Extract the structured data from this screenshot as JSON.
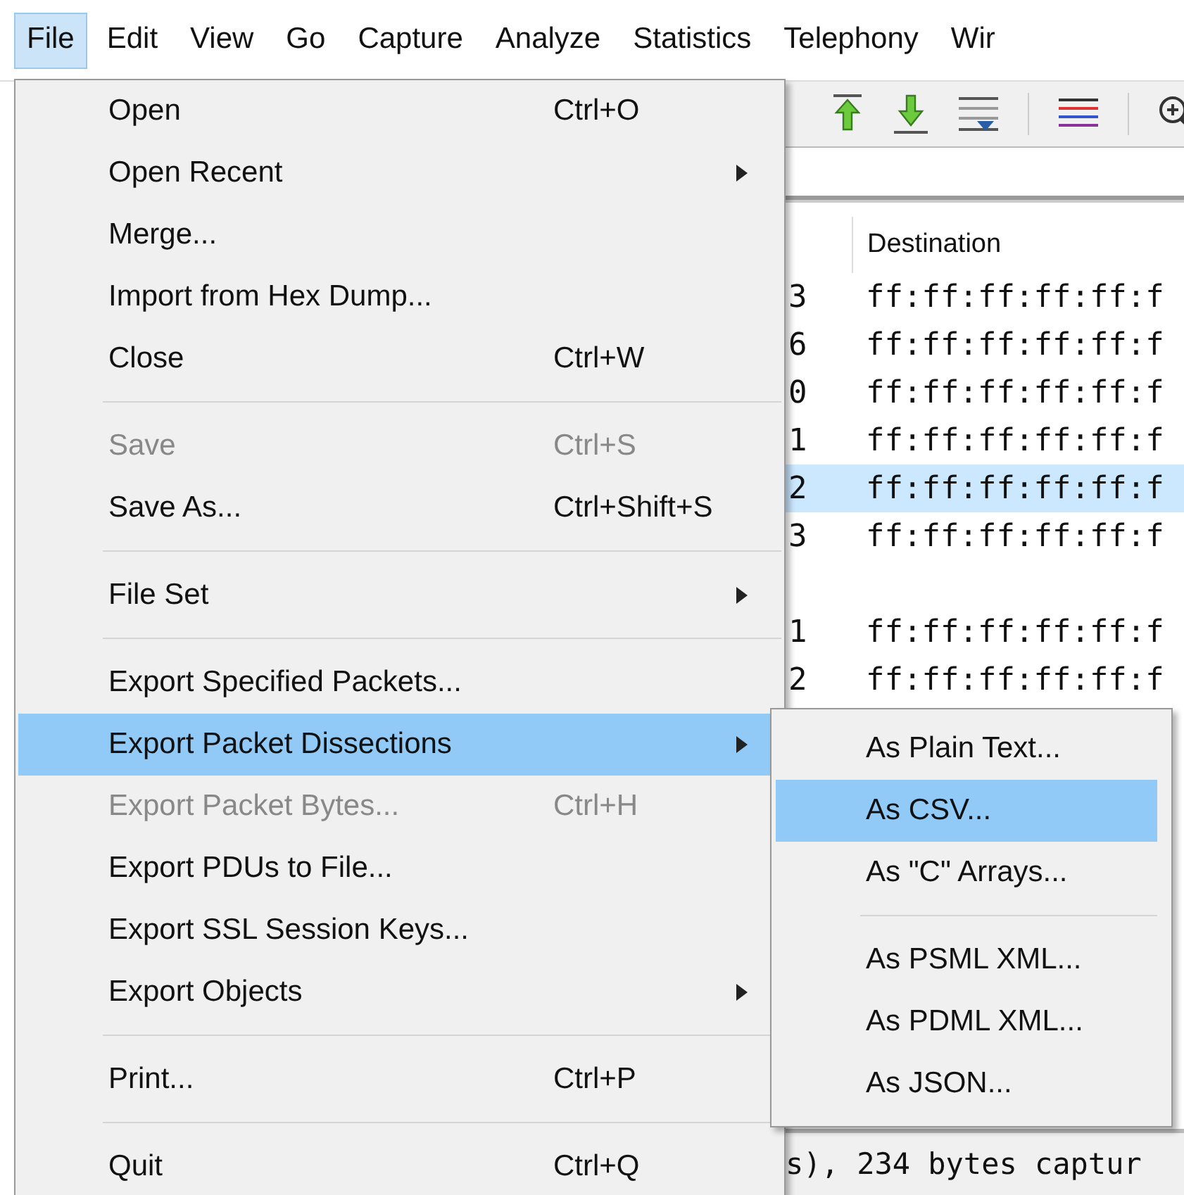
{
  "menu_bar": [
    {
      "label": "File",
      "selected": true
    },
    {
      "label": "Edit",
      "selected": false
    },
    {
      "label": "View",
      "selected": false
    },
    {
      "label": "Go",
      "selected": false
    },
    {
      "label": "Capture",
      "selected": false
    },
    {
      "label": "Analyze",
      "selected": false
    },
    {
      "label": "Statistics",
      "selected": false
    },
    {
      "label": "Telephony",
      "selected": false
    },
    {
      "label": "Wir",
      "selected": false
    }
  ],
  "packet_list": {
    "columns": [
      "Destination"
    ],
    "rows": [
      {
        "column_1": "3",
        "destination": "ff:ff:ff:ff:ff:f",
        "selected": false
      },
      {
        "column_1": "6",
        "destination": "ff:ff:ff:ff:ff:f",
        "selected": false
      },
      {
        "column_1": "0",
        "destination": "ff:ff:ff:ff:ff:f",
        "selected": false
      },
      {
        "column_1": "1",
        "destination": "ff:ff:ff:ff:ff:f",
        "selected": false
      },
      {
        "column_1": "2",
        "destination": "ff:ff:ff:ff:ff:f",
        "selected": true
      },
      {
        "column_1": "3",
        "destination": "ff:ff:ff:ff:ff:f",
        "selected": false
      },
      {
        "column_1": "",
        "destination": "",
        "selected": false
      },
      {
        "column_1": "1",
        "destination": "ff:ff:ff:ff:ff:f",
        "selected": false
      },
      {
        "column_1": "2",
        "destination": "ff:ff:ff:ff:ff:f",
        "selected": false
      }
    ]
  },
  "status_bar": "s), 234 bytes captur",
  "file_menu": [
    {
      "kind": "item",
      "label": "Open",
      "shortcut": "Ctrl+O",
      "submenu": false,
      "disabled": false,
      "selected": false
    },
    {
      "kind": "item",
      "label": "Open Recent",
      "submenu": true,
      "disabled": false,
      "selected": false
    },
    {
      "kind": "item",
      "label": "Merge...",
      "submenu": false,
      "disabled": false,
      "selected": false
    },
    {
      "kind": "item",
      "label": "Import from Hex Dump...",
      "submenu": false,
      "disabled": false,
      "selected": false
    },
    {
      "kind": "item",
      "label": "Close",
      "shortcut": "Ctrl+W",
      "submenu": false,
      "disabled": false,
      "selected": false
    },
    {
      "kind": "separator"
    },
    {
      "kind": "item",
      "label": "Save",
      "shortcut": "Ctrl+S",
      "submenu": false,
      "disabled": true,
      "selected": false
    },
    {
      "kind": "item",
      "label": "Save As...",
      "shortcut": "Ctrl+Shift+S",
      "submenu": false,
      "disabled": false,
      "selected": false
    },
    {
      "kind": "separator"
    },
    {
      "kind": "item",
      "label": "File Set",
      "submenu": true,
      "disabled": false,
      "selected": false
    },
    {
      "kind": "separator"
    },
    {
      "kind": "item",
      "label": "Export Specified Packets...",
      "submenu": false,
      "disabled": false,
      "selected": false
    },
    {
      "kind": "item",
      "label": "Export Packet Dissections",
      "submenu": true,
      "disabled": false,
      "selected": true
    },
    {
      "kind": "item",
      "label": "Export Packet Bytes...",
      "shortcut": "Ctrl+H",
      "submenu": false,
      "disabled": true,
      "selected": false
    },
    {
      "kind": "item",
      "label": "Export PDUs to File...",
      "submenu": false,
      "disabled": false,
      "selected": false
    },
    {
      "kind": "item",
      "label": "Export SSL Session Keys...",
      "submenu": false,
      "disabled": false,
      "selected": false
    },
    {
      "kind": "item",
      "label": "Export Objects",
      "submenu": true,
      "disabled": false,
      "selected": false
    },
    {
      "kind": "separator"
    },
    {
      "kind": "item",
      "label": "Print...",
      "shortcut": "Ctrl+P",
      "submenu": false,
      "disabled": false,
      "selected": false
    },
    {
      "kind": "separator"
    },
    {
      "kind": "item",
      "label": "Quit",
      "shortcut": "Ctrl+Q",
      "submenu": false,
      "disabled": false,
      "selected": false
    }
  ],
  "export_submenu": [
    {
      "kind": "item",
      "label": "As Plain Text...",
      "selected": false
    },
    {
      "kind": "item",
      "label": "As CSV...",
      "selected": true
    },
    {
      "kind": "item",
      "label": "As \"C\" Arrays...",
      "selected": false
    },
    {
      "kind": "separator"
    },
    {
      "kind": "item",
      "label": "As PSML XML...",
      "selected": false
    },
    {
      "kind": "item",
      "label": "As PDML XML...",
      "selected": false
    },
    {
      "kind": "item",
      "label": "As JSON...",
      "selected": false
    }
  ]
}
